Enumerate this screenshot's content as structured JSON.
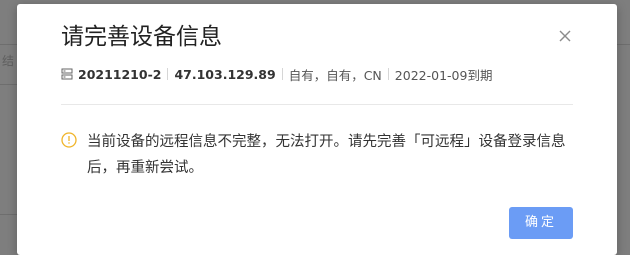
{
  "background": {
    "fragment": "结"
  },
  "dialog": {
    "title": "请完善设备信息",
    "close_icon": "close-icon",
    "meta": {
      "icon": "server-icon",
      "device_id": "20211210-2",
      "ip": "47.103.129.89",
      "ownership": "自有，自有，CN",
      "expiry": "2022-01-09到期"
    },
    "message": {
      "icon": "info-icon",
      "text": "当前设备的远程信息不完整，无法打开。请先完善「可远程」设备登录信息后，再重新尝试。"
    },
    "confirm_label": "确定"
  },
  "colors": {
    "overlay": "#7e7e7e",
    "primary_button": "#6b9cf5",
    "warning_icon": "#f0b429"
  }
}
